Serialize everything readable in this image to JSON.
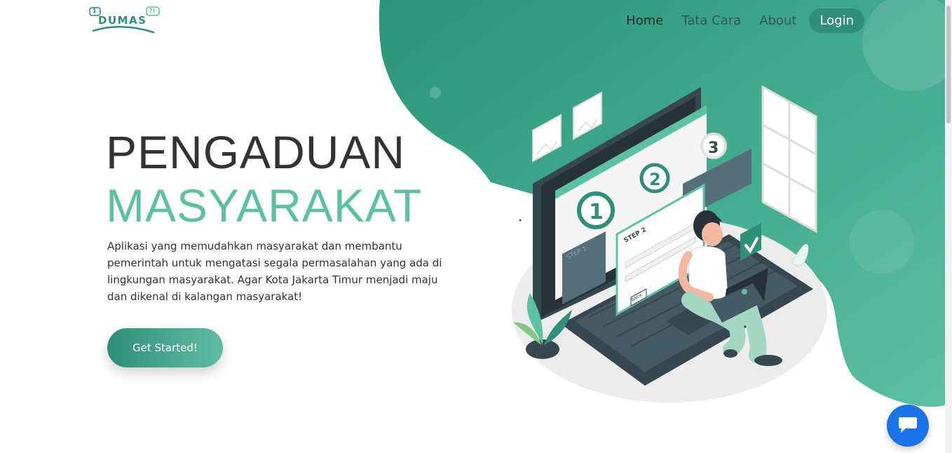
{
  "logo": {
    "text": "DUMAS",
    "icon_left": "1",
    "icon_right": "?!"
  },
  "nav": {
    "items": [
      {
        "label": "Home",
        "active": true
      },
      {
        "label": "Tata Cara",
        "active": false
      },
      {
        "label": "About",
        "active": false
      }
    ],
    "login_label": "Login"
  },
  "hero": {
    "title_line1": "PENGADUAN",
    "title_line2": "MASYARAKAT",
    "description": "Aplikasi yang memudahkan masyarakat dan membantu pemerintah untuk mengatasi segala permasalahan yang ada di lingkungan masyarakat. Agar Kota Jakarta Timur menjadi maju dan dikenal di kalangan masyarakat!",
    "cta_label": "Get Started!"
  },
  "illustration": {
    "steps": [
      "1",
      "2",
      "3"
    ],
    "form_title": "STEP 2",
    "form_button": "BACK",
    "side_panel_title": "STEP 1"
  },
  "icons": {
    "chat": "chat-bubble-icon"
  },
  "colors": {
    "accent": "#2f8f78",
    "accent_light": "#5cc0a2",
    "text_dark": "#333333",
    "chat_button": "#1a73e8"
  }
}
